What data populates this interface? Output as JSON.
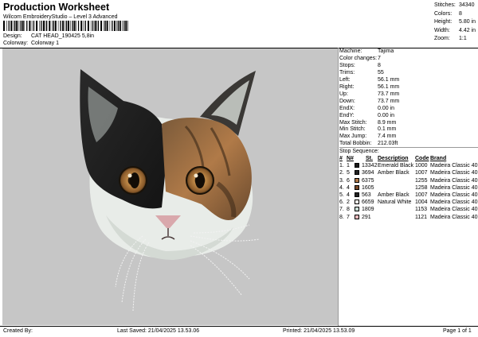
{
  "header": {
    "title": "Production Worksheet",
    "subtitle": "Wilcom EmbroideryStudio – Level 3 Advanced",
    "design_label": "Design:",
    "design_value": "CAT HEAD_190425 5,8in",
    "colorway_label": "Colorway:",
    "colorway_value": "Colorway 1",
    "stats": [
      {
        "label": "Stitches:",
        "value": "34340"
      },
      {
        "label": "Colors:",
        "value": "8"
      },
      {
        "label": "Height:",
        "value": "5.80 in"
      },
      {
        "label": "Width:",
        "value": "4.42 in"
      },
      {
        "label": "Zoom:",
        "value": "1:1"
      }
    ]
  },
  "machine_info": [
    {
      "label": "Machine:",
      "value": "Tajima"
    },
    {
      "label": "Color changes:",
      "value": "7"
    },
    {
      "label": "Stops:",
      "value": "8"
    },
    {
      "label": "Trims:",
      "value": "55"
    },
    {
      "label": "Left:",
      "value": "56.1 mm"
    },
    {
      "label": "Right:",
      "value": "56.1 mm"
    },
    {
      "label": "Up:",
      "value": "73.7 mm"
    },
    {
      "label": "Down:",
      "value": "73.7 mm"
    },
    {
      "label": "EndX:",
      "value": "0.00 in"
    },
    {
      "label": "EndY:",
      "value": "0.00 in"
    },
    {
      "label": "Max Stitch:",
      "value": "8.9 mm"
    },
    {
      "label": "Min Stitch:",
      "value": "0.1 mm"
    },
    {
      "label": "Max Jump:",
      "value": "7.4 mm"
    },
    {
      "label": "Total Bobbin:",
      "value": "212.03ft"
    }
  ],
  "stop_sequence": {
    "title": "Stop Sequence:",
    "headers": {
      "idx": "#",
      "num": "N#",
      "st": "St.",
      "desc": "Description",
      "code": "Code",
      "brand": "Brand"
    },
    "rows": [
      {
        "idx": "1.",
        "num": "1",
        "color": "#1a1a1a",
        "st": "13342",
        "desc": "Emerald Black",
        "code": "1000",
        "brand": "Madeira Classic 40"
      },
      {
        "idx": "2.",
        "num": "5",
        "color": "#222222",
        "st": "3694",
        "desc": "Amber Black",
        "code": "1007",
        "brand": "Madeira Classic 40"
      },
      {
        "idx": "3.",
        "num": "6",
        "color": "#b07a4a",
        "st": "6375",
        "desc": "",
        "code": "1255",
        "brand": "Madeira Classic 40"
      },
      {
        "idx": "4.",
        "num": "4",
        "color": "#7a4a2a",
        "st": "1605",
        "desc": "",
        "code": "1258",
        "brand": "Madeira Classic 40"
      },
      {
        "idx": "5.",
        "num": "4",
        "color": "#222222",
        "st": "563",
        "desc": "Amber Black",
        "code": "1007",
        "brand": "Madeira Classic 40"
      },
      {
        "idx": "6.",
        "num": "2",
        "color": "#f4f2ec",
        "st": "6659",
        "desc": "Natural White",
        "code": "1004",
        "brand": "Madeira Classic 40"
      },
      {
        "idx": "7.",
        "num": "8",
        "color": "#c9dcd4",
        "st": "1809",
        "desc": "",
        "code": "1153",
        "brand": "Madeira Classic 40"
      },
      {
        "idx": "8.",
        "num": "7",
        "color": "#e8b8bc",
        "st": "291",
        "desc": "",
        "code": "1121",
        "brand": "Madeira Classic 40"
      }
    ]
  },
  "footer": {
    "created_by": "Created By:",
    "last_saved": "Last Saved: 21/04/2025 13.53.06",
    "printed": "Printed: 21/04/2025 13.53.09",
    "page": "Page 1 of 1"
  }
}
